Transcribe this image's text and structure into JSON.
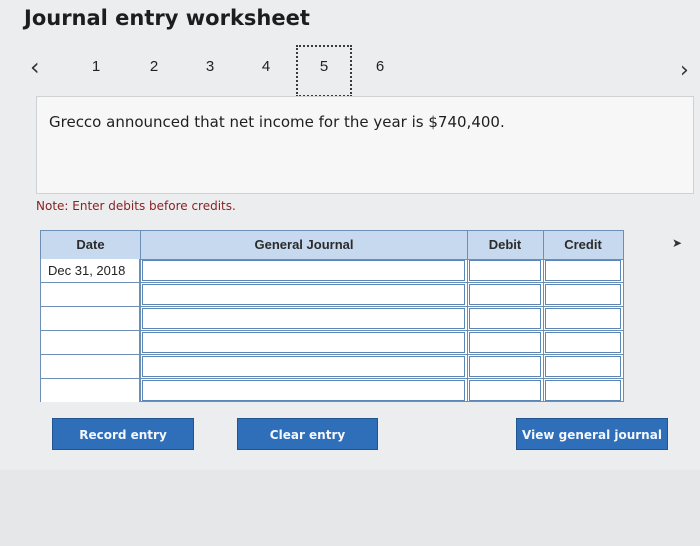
{
  "header": {
    "title": "Journal entry worksheet"
  },
  "nav": {
    "prev_icon": "‹",
    "next_icon": "›",
    "steps": [
      "1",
      "2",
      "3",
      "4",
      "5",
      "6"
    ],
    "current_step": "5"
  },
  "panel": {
    "statement": "Grecco announced that net income for the year is $740,400."
  },
  "note": "Note: Enter debits before credits.",
  "journal": {
    "columns": {
      "date": "Date",
      "general_journal": "General Journal",
      "debit": "Debit",
      "credit": "Credit"
    },
    "rows": [
      {
        "date": "Dec 31, 2018",
        "account": "",
        "debit": "",
        "credit": ""
      },
      {
        "date": "",
        "account": "",
        "debit": "",
        "credit": ""
      },
      {
        "date": "",
        "account": "",
        "debit": "",
        "credit": ""
      },
      {
        "date": "",
        "account": "",
        "debit": "",
        "credit": ""
      },
      {
        "date": "",
        "account": "",
        "debit": "",
        "credit": ""
      },
      {
        "date": "",
        "account": "",
        "debit": "",
        "credit": ""
      }
    ]
  },
  "buttons": {
    "record": "Record entry",
    "clear": "Clear entry",
    "view": "View general journal"
  },
  "colors": {
    "button_blue": "#2f6fba",
    "header_blue": "#c7d9ef",
    "note_red": "#8a1f1f"
  }
}
